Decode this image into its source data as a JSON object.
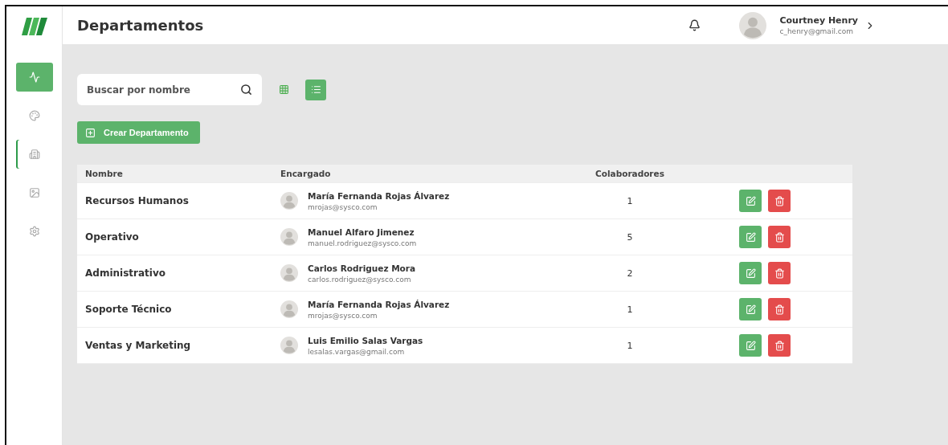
{
  "header": {
    "title": "Departamentos",
    "user": {
      "name": "Courtney Henry",
      "email": "c_henry@gmail.com"
    }
  },
  "sidebar": {
    "items": [
      {
        "selected": true,
        "marked": false
      },
      {
        "selected": false,
        "marked": false
      },
      {
        "selected": false,
        "marked": true
      },
      {
        "selected": false,
        "marked": false
      },
      {
        "selected": false,
        "marked": false
      }
    ]
  },
  "search": {
    "placeholder": "Buscar por nombre"
  },
  "view_toggle": [
    {
      "selected": false
    },
    {
      "selected": true
    }
  ],
  "create_button": "Crear Departamento",
  "table": {
    "columns": [
      "Nombre",
      "Encargado",
      "Colaboradores"
    ],
    "rows": [
      {
        "name": "Recursos Humanos",
        "manager": "María Fernanda Rojas Álvarez",
        "email": "mrojas@sysco.com",
        "count": "1"
      },
      {
        "name": "Operativo",
        "manager": "Manuel Alfaro Jimenez",
        "email": "manuel.rodriguez@sysco.com",
        "count": "5"
      },
      {
        "name": "Administrativo",
        "manager": "Carlos Rodriguez Mora",
        "email": "carlos.rodriguez@sysco.com",
        "count": "2"
      },
      {
        "name": "Soporte Técnico",
        "manager": "María Fernanda Rojas Álvarez",
        "email": "mrojas@sysco.com",
        "count": "1"
      },
      {
        "name": "Ventas y Marketing",
        "manager": "Luis Emilio Salas Vargas",
        "email": "lesalas.vargas@gmail.com",
        "count": "1"
      }
    ]
  }
}
